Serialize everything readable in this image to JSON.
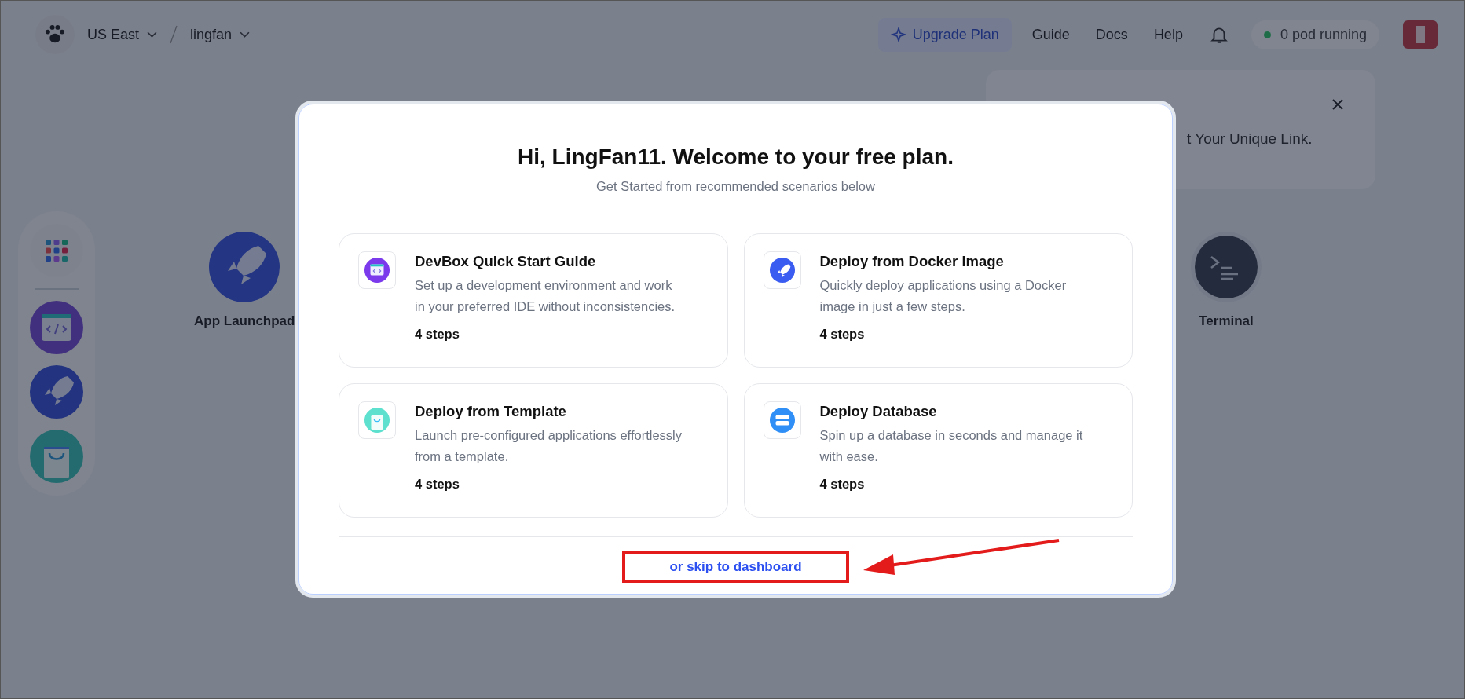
{
  "top_bar": {
    "region": "US East",
    "workspace": "lingfan",
    "upgrade_button": "Upgrade Plan",
    "links": [
      "Guide",
      "Docs",
      "Help"
    ],
    "status": "0 pod running"
  },
  "notification": {
    "text": "t Your Unique Link."
  },
  "desktop_apps": [
    {
      "label": "App Launchpad",
      "kind": "rocket"
    },
    {
      "label": "Terminal",
      "kind": "terminal"
    }
  ],
  "modal": {
    "title": "Hi, LingFan11. Welcome to your free plan.",
    "subtitle": "Get Started from recommended scenarios below",
    "cards": [
      {
        "kind": "devbox",
        "title": "DevBox Quick Start Guide",
        "description": "Set up a development environment and work in your preferred IDE without inconsistencies.",
        "steps": "4 steps"
      },
      {
        "kind": "docker",
        "title": "Deploy from Docker Image",
        "description": "Quickly deploy applications using a Docker image in just a few steps.",
        "steps": "4 steps"
      },
      {
        "kind": "template",
        "title": "Deploy from Template",
        "description": "Launch pre-configured applications effortlessly from a template.",
        "steps": "4 steps"
      },
      {
        "kind": "database",
        "title": "Deploy Database",
        "description": "Spin up a database in seconds and manage it with ease.",
        "steps": "4 steps"
      }
    ],
    "skip_link": "or skip to dashboard"
  }
}
